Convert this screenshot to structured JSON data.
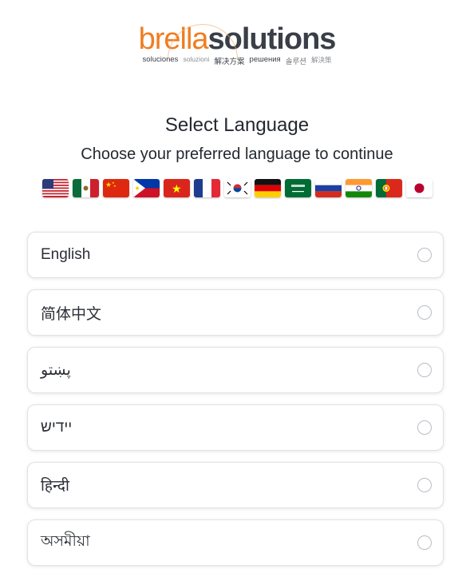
{
  "logo": {
    "brand_part1": "brella",
    "brand_part2": "solutions",
    "tagline": [
      "soluciones",
      "soluzioni",
      "解决方案",
      "решения",
      "솔루션",
      "解決策"
    ]
  },
  "heading": {
    "title": "Select Language",
    "subtitle": "Choose your preferred language to continue"
  },
  "flags": [
    "flag-us-icon",
    "flag-mx-icon",
    "flag-cn-icon",
    "flag-ph-icon",
    "flag-vn-icon",
    "flag-fr-icon",
    "flag-kr-icon",
    "flag-de-icon",
    "flag-sa-icon",
    "flag-ru-icon",
    "flag-in-icon",
    "flag-pt-icon",
    "flag-jp-icon"
  ],
  "languages": [
    {
      "label": "English",
      "selected": false
    },
    {
      "label": "简体中文",
      "selected": false
    },
    {
      "label": "پښتو",
      "selected": false
    },
    {
      "label": "יידיש",
      "selected": false
    },
    {
      "label": "हिन्दी",
      "selected": false
    },
    {
      "label": "অসমীয়া",
      "selected": false
    }
  ],
  "colors": {
    "brand_orange": "#ef7d21",
    "brand_dark": "#3a3f47",
    "border": "#dfe2e6"
  }
}
